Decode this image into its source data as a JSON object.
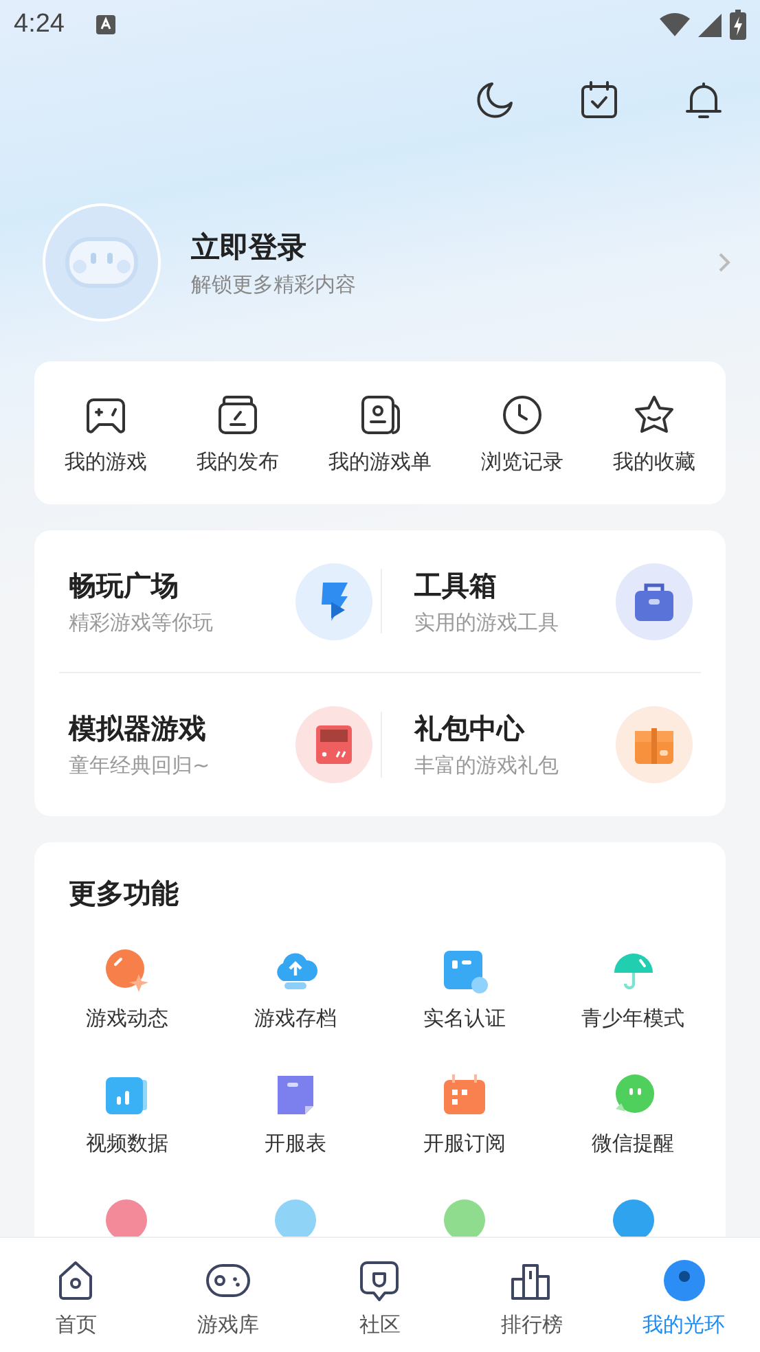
{
  "status_bar": {
    "time": "4:24"
  },
  "profile": {
    "title": "立即登录",
    "subtitle": "解锁更多精彩内容"
  },
  "shortcuts": [
    {
      "label": "我的游戏"
    },
    {
      "label": "我的发布"
    },
    {
      "label": "我的游戏单"
    },
    {
      "label": "浏览记录"
    },
    {
      "label": "我的收藏"
    }
  ],
  "features": [
    {
      "title": "畅玩广场",
      "subtitle": "精彩游戏等你玩"
    },
    {
      "title": "工具箱",
      "subtitle": "实用的游戏工具"
    },
    {
      "title": "模拟器游戏",
      "subtitle": "童年经典回归~"
    },
    {
      "title": "礼包中心",
      "subtitle": "丰富的游戏礼包"
    }
  ],
  "more": {
    "title": "更多功能",
    "items": [
      {
        "label": "游戏动态"
      },
      {
        "label": "游戏存档"
      },
      {
        "label": "实名认证"
      },
      {
        "label": "青少年模式"
      },
      {
        "label": "视频数据"
      },
      {
        "label": "开服表"
      },
      {
        "label": "开服订阅"
      },
      {
        "label": "微信提醒"
      }
    ]
  },
  "nav": [
    {
      "label": "首页",
      "selected": false
    },
    {
      "label": "游戏库",
      "selected": false
    },
    {
      "label": "社区",
      "selected": false
    },
    {
      "label": "排行榜",
      "selected": false
    },
    {
      "label": "我的光环",
      "selected": true
    }
  ]
}
